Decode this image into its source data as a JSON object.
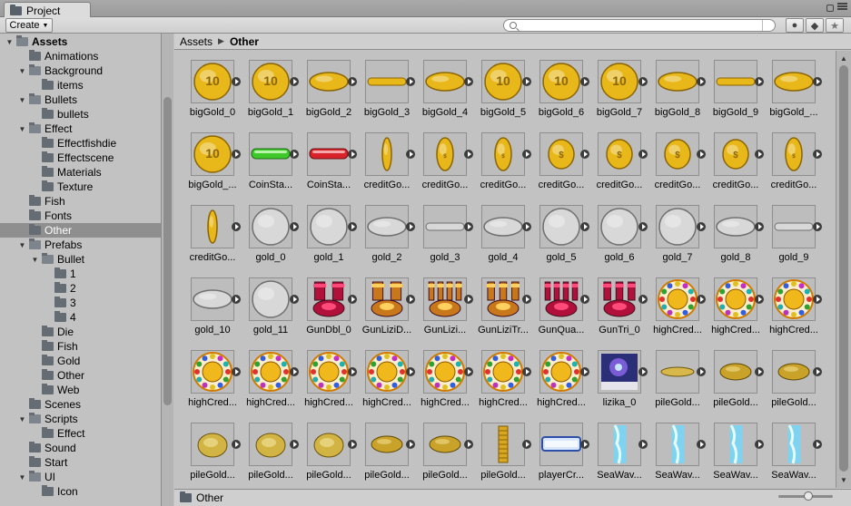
{
  "window": {
    "tab_label": "Project"
  },
  "toolbar": {
    "create_label": "Create",
    "search_placeholder": ""
  },
  "breadcrumb": {
    "root": "Assets",
    "current": "Other"
  },
  "status": {
    "path": "Other",
    "thumbnail_size_fraction": 0.55
  },
  "tree": [
    {
      "label": "Assets",
      "depth": 0,
      "expanded": true,
      "bold": true
    },
    {
      "label": "Animations",
      "depth": 1
    },
    {
      "label": "Background",
      "depth": 1,
      "expanded": true
    },
    {
      "label": "items",
      "depth": 2
    },
    {
      "label": "Bullets",
      "depth": 1,
      "expanded": true
    },
    {
      "label": "bullets",
      "depth": 2
    },
    {
      "label": "Effect",
      "depth": 1,
      "expanded": true
    },
    {
      "label": "Effectfishdie",
      "depth": 2
    },
    {
      "label": "Effectscene",
      "depth": 2
    },
    {
      "label": "Materials",
      "depth": 2
    },
    {
      "label": "Texture",
      "depth": 2
    },
    {
      "label": "Fish",
      "depth": 1
    },
    {
      "label": "Fonts",
      "depth": 1
    },
    {
      "label": "Other",
      "depth": 1,
      "selected": true
    },
    {
      "label": "Prefabs",
      "depth": 1,
      "expanded": true
    },
    {
      "label": "Bullet",
      "depth": 2,
      "expanded": true
    },
    {
      "label": "1",
      "depth": 3
    },
    {
      "label": "2",
      "depth": 3
    },
    {
      "label": "3",
      "depth": 3
    },
    {
      "label": "4",
      "depth": 3
    },
    {
      "label": "Die",
      "depth": 2
    },
    {
      "label": "Fish",
      "depth": 2
    },
    {
      "label": "Gold",
      "depth": 2
    },
    {
      "label": "Other",
      "depth": 2
    },
    {
      "label": "Web",
      "depth": 2
    },
    {
      "label": "Scenes",
      "depth": 1
    },
    {
      "label": "Scripts",
      "depth": 1,
      "expanded": true
    },
    {
      "label": "Effect",
      "depth": 2
    },
    {
      "label": "Sound",
      "depth": 1
    },
    {
      "label": "Start",
      "depth": 1
    },
    {
      "label": "UI",
      "depth": 1,
      "expanded": true
    },
    {
      "label": "Icon",
      "depth": 2
    }
  ],
  "assets": [
    {
      "label": "bigGold_0",
      "kind": "goldcoin"
    },
    {
      "label": "bigGold_1",
      "kind": "goldcoin"
    },
    {
      "label": "bigGold_2",
      "kind": "goldtilt"
    },
    {
      "label": "bigGold_3",
      "kind": "goldedge"
    },
    {
      "label": "bigGold_4",
      "kind": "goldtilt"
    },
    {
      "label": "bigGold_5",
      "kind": "goldcoin"
    },
    {
      "label": "bigGold_6",
      "kind": "goldcoin"
    },
    {
      "label": "bigGold_7",
      "kind": "goldcoin"
    },
    {
      "label": "bigGold_8",
      "kind": "goldtilt"
    },
    {
      "label": "bigGold_9",
      "kind": "goldedge"
    },
    {
      "label": "bigGold_...",
      "kind": "goldtilt"
    },
    {
      "label": "bigGold_...",
      "kind": "goldcoin"
    },
    {
      "label": "CoinSta...",
      "kind": "greenbar"
    },
    {
      "label": "CoinSta...",
      "kind": "redbar"
    },
    {
      "label": "creditGo...",
      "kind": "goldthin"
    },
    {
      "label": "creditGo...",
      "kind": "goldnarrow"
    },
    {
      "label": "creditGo...",
      "kind": "goldnarrow"
    },
    {
      "label": "creditGo...",
      "kind": "goldsmall"
    },
    {
      "label": "creditGo...",
      "kind": "goldsmall"
    },
    {
      "label": "creditGo...",
      "kind": "goldsmall"
    },
    {
      "label": "creditGo...",
      "kind": "goldsmall"
    },
    {
      "label": "creditGo...",
      "kind": "goldnarrow"
    },
    {
      "label": "creditGo...",
      "kind": "goldthin"
    },
    {
      "label": "gold_0",
      "kind": "silvercoin"
    },
    {
      "label": "gold_1",
      "kind": "silvercoin"
    },
    {
      "label": "gold_2",
      "kind": "silvertilt"
    },
    {
      "label": "gold_3",
      "kind": "silveredge"
    },
    {
      "label": "gold_4",
      "kind": "silvertilt"
    },
    {
      "label": "gold_5",
      "kind": "silvercoin"
    },
    {
      "label": "gold_6",
      "kind": "silvercoin"
    },
    {
      "label": "gold_7",
      "kind": "silvercoin"
    },
    {
      "label": "gold_8",
      "kind": "silvertilt"
    },
    {
      "label": "gold_9",
      "kind": "silveredge"
    },
    {
      "label": "gold_10",
      "kind": "silvertilt"
    },
    {
      "label": "gold_11",
      "kind": "silvercoin"
    },
    {
      "label": "GunDbl_0",
      "kind": "gunred2"
    },
    {
      "label": "GunLiziD...",
      "kind": "gunorange2"
    },
    {
      "label": "GunLizi...",
      "kind": "gunorange4"
    },
    {
      "label": "GunLiziTr...",
      "kind": "gunorange3"
    },
    {
      "label": "GunQua...",
      "kind": "gunred4"
    },
    {
      "label": "GunTri_0",
      "kind": "gunred3"
    },
    {
      "label": "highCred...",
      "kind": "wheel"
    },
    {
      "label": "highCred...",
      "kind": "wheel"
    },
    {
      "label": "highCred...",
      "kind": "wheel"
    },
    {
      "label": "highCred...",
      "kind": "wheel"
    },
    {
      "label": "highCred...",
      "kind": "wheel"
    },
    {
      "label": "highCred...",
      "kind": "wheel"
    },
    {
      "label": "highCred...",
      "kind": "wheel"
    },
    {
      "label": "highCred...",
      "kind": "wheel"
    },
    {
      "label": "highCred...",
      "kind": "wheel"
    },
    {
      "label": "highCred...",
      "kind": "wheel"
    },
    {
      "label": "lizika_0",
      "kind": "lizika"
    },
    {
      "label": "pileGold...",
      "kind": "pileflat"
    },
    {
      "label": "pileGold...",
      "kind": "pileoval"
    },
    {
      "label": "pileGold...",
      "kind": "pileoval"
    },
    {
      "label": "pileGold...",
      "kind": "pileround"
    },
    {
      "label": "pileGold...",
      "kind": "pileround"
    },
    {
      "label": "pileGold...",
      "kind": "pileround"
    },
    {
      "label": "pileGold...",
      "kind": "pileoval"
    },
    {
      "label": "pileGold...",
      "kind": "pileoval"
    },
    {
      "label": "pileGold...",
      "kind": "pilestack"
    },
    {
      "label": "playerCr...",
      "kind": "bluebar"
    },
    {
      "label": "SeaWav...",
      "kind": "seawave"
    },
    {
      "label": "SeaWav...",
      "kind": "seawave"
    },
    {
      "label": "SeaWav...",
      "kind": "seawave"
    },
    {
      "label": "SeaWav...",
      "kind": "seawave"
    }
  ]
}
